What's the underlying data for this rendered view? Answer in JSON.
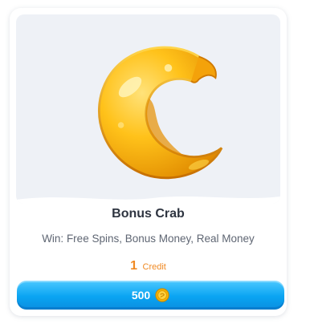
{
  "card": {
    "image_icon": "crescent-crab-illustration",
    "title": "Bonus Crab",
    "subtitle": "Win: Free Spins, Bonus Money, Real Money",
    "credit_amount": "1",
    "credit_label": "Credit",
    "price": "500",
    "price_icon": "gold-coin-icon"
  },
  "colors": {
    "title": "#2e3440",
    "credit": "#f08a24",
    "button": "#0aa4f2",
    "panel_background": "#eef1f6"
  }
}
